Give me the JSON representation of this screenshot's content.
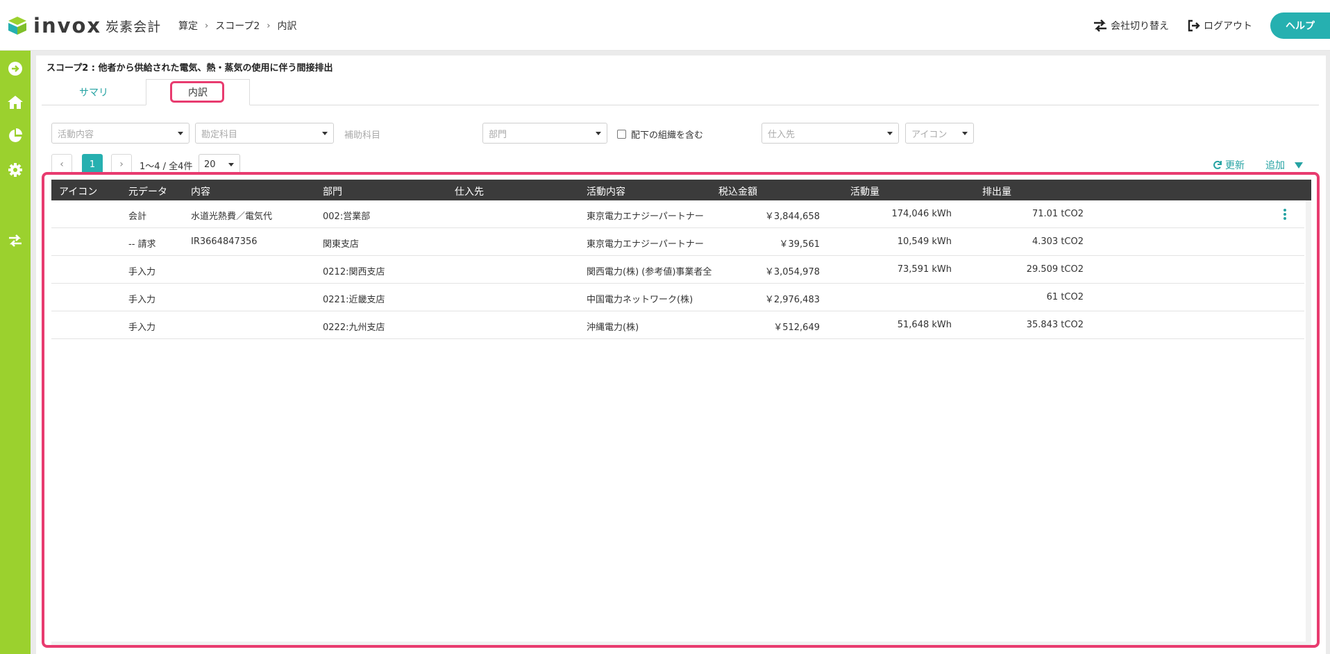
{
  "header": {
    "logo_text": "invox",
    "logo_sub": "炭素会計",
    "breadcrumb": [
      "算定",
      "スコープ2",
      "内訳"
    ],
    "company_switch": "会社切り替え",
    "logout": "ログアウト",
    "help": "ヘルプ"
  },
  "colors": {
    "accent": "#26b0b0",
    "sidebar": "#9bd12e",
    "highlight": "#e83b6f",
    "table_header": "#3b3b3b"
  },
  "sidebar": {
    "items": [
      {
        "icon": "arrow-right-circle-icon"
      },
      {
        "icon": "home-icon"
      },
      {
        "icon": "pie-chart-icon"
      },
      {
        "icon": "gear-icon"
      },
      {
        "icon": "switch-icon"
      }
    ]
  },
  "page": {
    "title": "スコープ2 : 他者から供給された電気、熱・蒸気の使用に伴う間接排出",
    "tabs": [
      "サマリ",
      "内訳"
    ]
  },
  "filters": {
    "activity": "活動内容",
    "account": "勘定科目",
    "sub_account": "補助科目",
    "department": "部門",
    "include_sub_org": "配下の組織を含む",
    "supplier": "仕入先",
    "icon": "アイコン"
  },
  "pager": {
    "current": "1",
    "info": "1〜4 / 全4件",
    "page_size": "20",
    "refresh": "更新",
    "add": "追加"
  },
  "table": {
    "headers": [
      "アイコン",
      "元データ",
      "内容",
      "部門",
      "仕入先",
      "活動内容",
      "税込金額",
      "活動量",
      "排出量"
    ],
    "rows": [
      {
        "source": "会計",
        "content": "水道光熱費／電気代",
        "dept": "002:営業部",
        "supplier": "",
        "activity": "東京電力エナジーパートナー",
        "amount": "￥3,844,658",
        "quantity": "174,046 kWh",
        "emission": "71.01 tCO2",
        "menu": true
      },
      {
        "source": "-- 請求",
        "content": "IR3664847356",
        "dept": "関東支店",
        "supplier": "",
        "activity": "東京電力エナジーパートナー",
        "amount": "￥39,561",
        "quantity": "10,549 kWh",
        "emission": "4.303 tCO2",
        "menu": false
      },
      {
        "source": "手入力",
        "content": "",
        "dept": "0212:関西支店",
        "supplier": "",
        "activity": "関西電力(株) (参考値)事業者全",
        "amount": "￥3,054,978",
        "quantity": "73,591 kWh",
        "emission": "29.509 tCO2",
        "menu": false
      },
      {
        "source": "手入力",
        "content": "",
        "dept": "0221:近畿支店",
        "supplier": "",
        "activity": "中国電力ネットワーク(株)",
        "amount": "￥2,976,483",
        "quantity": "",
        "emission": "61 tCO2",
        "menu": false
      },
      {
        "source": "手入力",
        "content": "",
        "dept": "0222:九州支店",
        "supplier": "",
        "activity": "沖縄電力(株)",
        "amount": "￥512,649",
        "quantity": "51,648 kWh",
        "emission": "35.843 tCO2",
        "menu": false
      }
    ]
  }
}
